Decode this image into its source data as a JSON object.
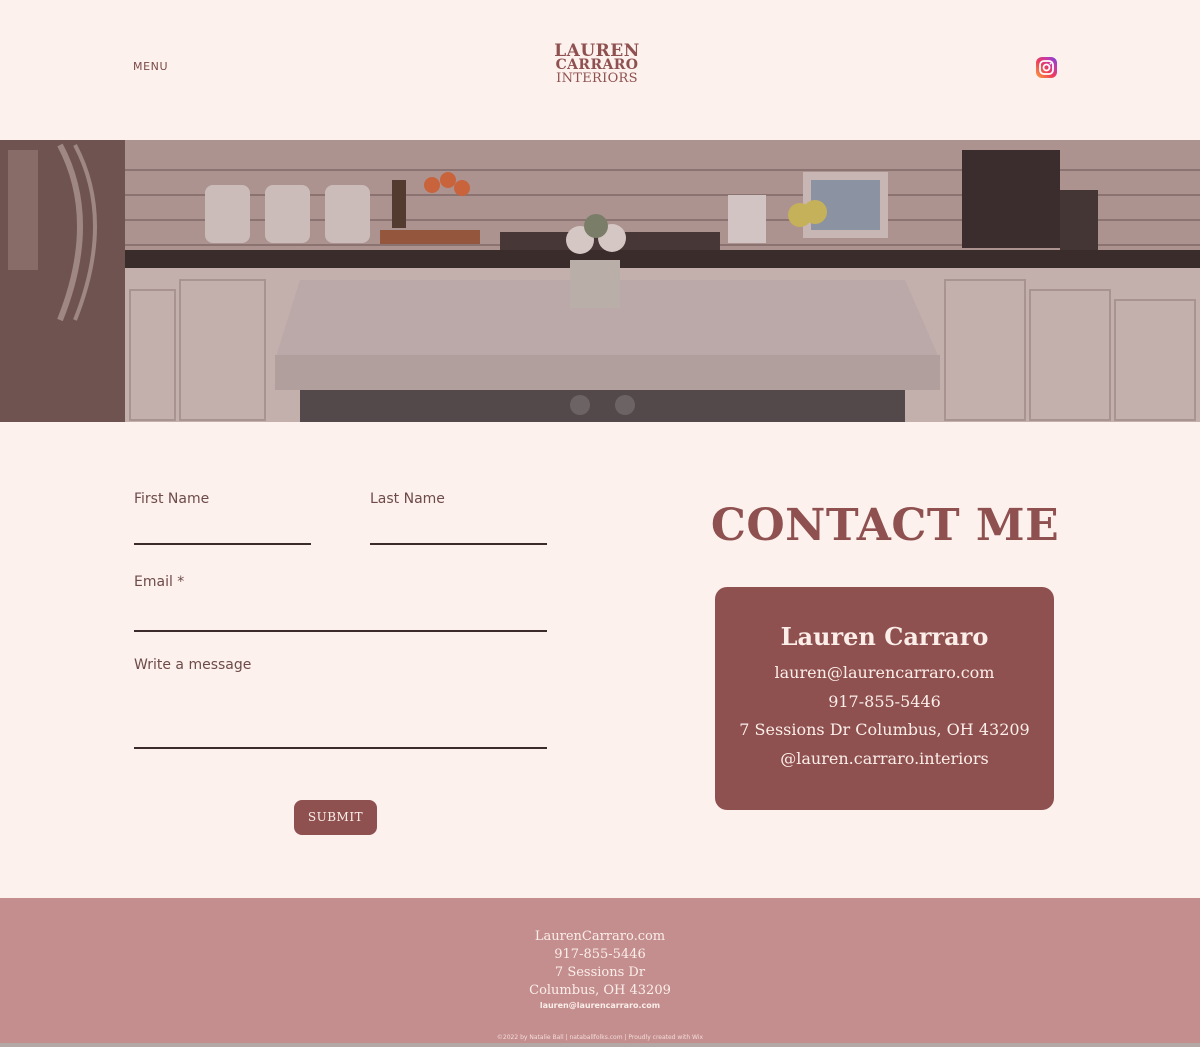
{
  "header": {
    "menu_label": "MENU",
    "logo": {
      "line1": "LAUREN",
      "line2": "CARRARO",
      "line3": "INTERIORS"
    },
    "social_icon": "instagram-icon"
  },
  "hero": {
    "image": "kitchen-island-photo"
  },
  "form": {
    "first_name_label": "First Name",
    "last_name_label": "Last Name",
    "email_label": "Email *",
    "message_label": "Write a message",
    "first_name_value": "",
    "last_name_value": "",
    "email_value": "",
    "message_value": "",
    "submit_label": "SUBMIT"
  },
  "contact": {
    "title": "CONTACT ME",
    "name": "Lauren Carraro",
    "email": "lauren@laurencarraro.com",
    "phone": "917-855-5446",
    "address": "7 Sessions Dr Columbus, OH 43209",
    "instagram": "@lauren.carraro.interiors"
  },
  "footer": {
    "site": "LaurenCarraro.com",
    "phone": "917-855-5446",
    "street": "7 Sessions Dr",
    "city": "Columbus, OH 43209",
    "email": "lauren@laurencarraro.com",
    "copyright": "©2022 by Natalie Ball  |  nataballfolks.com  |  Proudly created with Wix"
  },
  "colors": {
    "background": "#fcf1ec",
    "accent": "#8f5050",
    "footer": "#c48e8e"
  }
}
